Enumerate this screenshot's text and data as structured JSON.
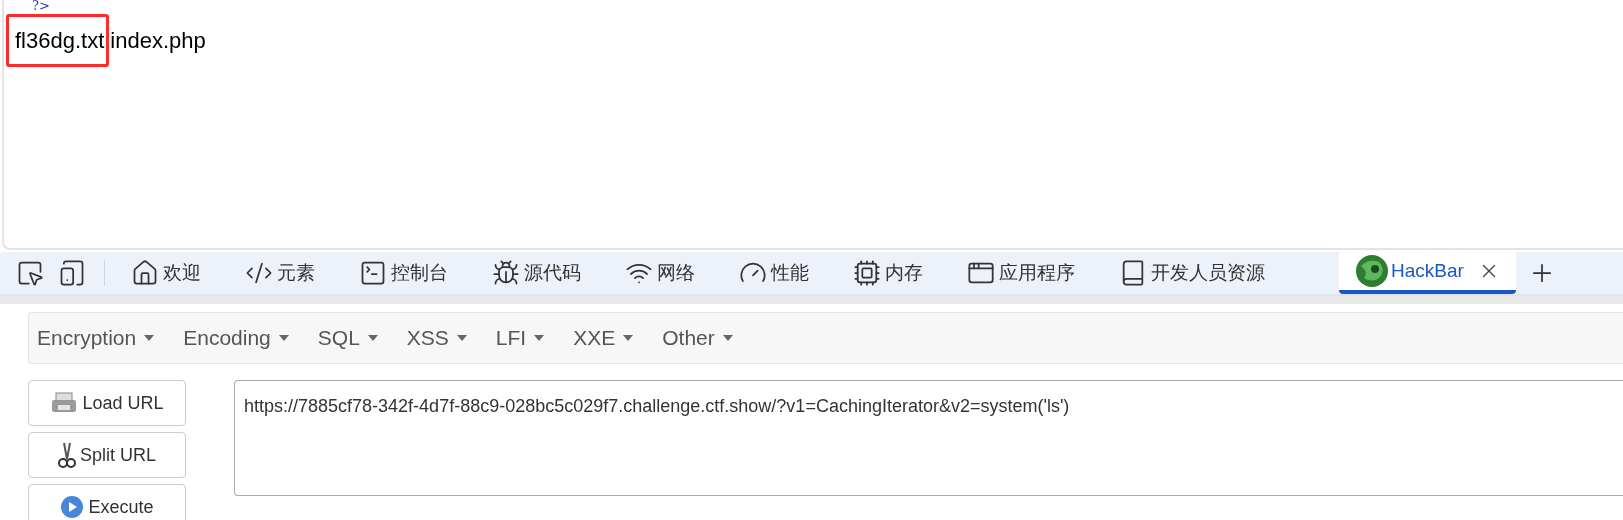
{
  "page": {
    "code_tail": "?>",
    "files": [
      {
        "name": "fl36dg.txt",
        "highlighted": true
      },
      {
        "name": "index.php",
        "highlighted": false
      }
    ]
  },
  "devtools_tabs": [
    {
      "kind": "inspect",
      "selected": false
    },
    {
      "kind": "device",
      "selected": false
    },
    {
      "kind": "home",
      "label": "欢迎",
      "selected": false
    },
    {
      "kind": "elements",
      "label": "元素",
      "selected": false
    },
    {
      "kind": "console",
      "label": "控制台",
      "selected": false
    },
    {
      "kind": "sources",
      "label": "源代码",
      "selected": false
    },
    {
      "kind": "network",
      "label": "网络",
      "selected": false
    },
    {
      "kind": "performance",
      "label": "性能",
      "selected": false
    },
    {
      "kind": "memory",
      "label": "内存",
      "selected": false
    },
    {
      "kind": "application",
      "label": "应用程序",
      "selected": false
    },
    {
      "kind": "resources",
      "label": "开发人员资源",
      "selected": false
    },
    {
      "kind": "hackbar",
      "label": "HackBar",
      "selected": true
    }
  ],
  "hackbar": {
    "menus": [
      "Encryption",
      "Encoding",
      "SQL",
      "XSS",
      "LFI",
      "XXE",
      "Other"
    ],
    "buttons": [
      {
        "kind": "load",
        "label": "Load URL"
      },
      {
        "kind": "split",
        "label": "Split URL"
      },
      {
        "kind": "execute",
        "label": "Execute"
      }
    ],
    "url": "https://7885cf78-342f-4d7f-88c9-028bc5c029f7.challenge.ctf.show/?v1=CachingIterator&v2=system('ls')"
  }
}
